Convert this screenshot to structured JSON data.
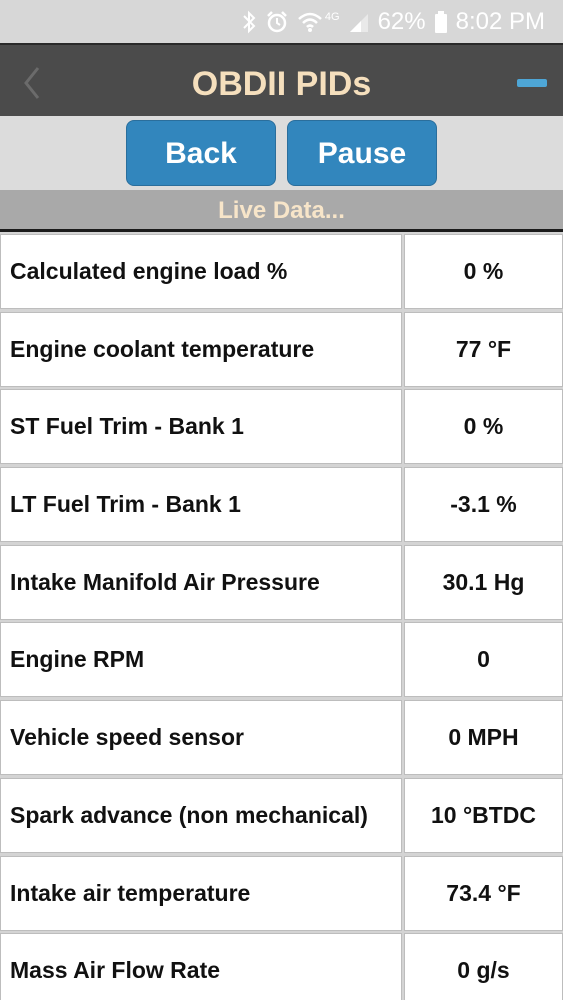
{
  "status_bar": {
    "battery_percent": "62%",
    "time": "8:02 PM",
    "network_label": "4G",
    "icons": [
      "bluetooth-icon",
      "alarm-icon",
      "wifi-icon",
      "signal-icon",
      "battery-icon"
    ]
  },
  "app_bar": {
    "title": "OBDII PIDs",
    "back_icon": "chevron-left-icon",
    "menu_icon": "minus-icon"
  },
  "toolbar": {
    "back_label": "Back",
    "pause_label": "Pause"
  },
  "section": {
    "header": "Live Data..."
  },
  "pids": [
    {
      "name": "Calculated engine load %",
      "value": "0 %"
    },
    {
      "name": "Engine coolant temperature",
      "value": "77 °F"
    },
    {
      "name": "ST Fuel Trim - Bank 1",
      "value": "0 %"
    },
    {
      "name": "LT Fuel Trim - Bank 1",
      "value": "-3.1 %"
    },
    {
      "name": "Intake Manifold Air Pressure",
      "value": "30.1 Hg"
    },
    {
      "name": "Engine RPM",
      "value": "0"
    },
    {
      "name": "Vehicle speed sensor",
      "value": "0 MPH"
    },
    {
      "name": "Spark advance (non mechanical)",
      "value": "10 °BTDC"
    },
    {
      "name": "Intake air temperature",
      "value": "73.4 °F"
    },
    {
      "name": "Mass Air Flow Rate",
      "value": "0 g/s"
    }
  ],
  "colors": {
    "app_bar_bg": "#4b4b4b",
    "title_color": "#f5dfbd",
    "button_blue": "#3286bd",
    "accent_minus": "#4ea6d6",
    "section_header_bg": "#a9a9a9"
  }
}
